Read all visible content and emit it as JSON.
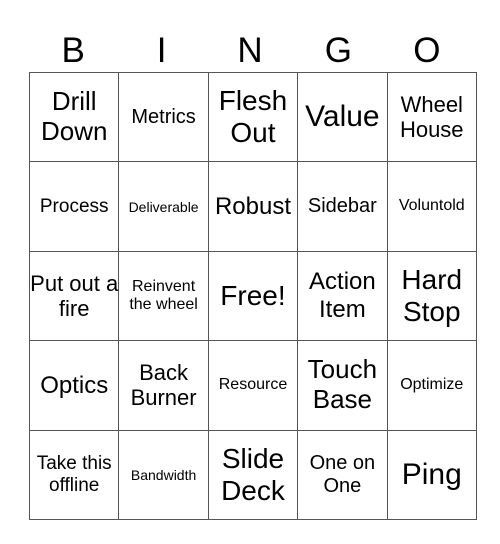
{
  "header": [
    "B",
    "I",
    "N",
    "G",
    "O"
  ],
  "rows": [
    [
      "Drill Down",
      "Metrics",
      "Flesh Out",
      "Value",
      "Wheel House"
    ],
    [
      "Process",
      "Deliverable",
      "Robust",
      "Sidebar",
      "Voluntold"
    ],
    [
      "Put out a fire",
      "Reinvent the wheel",
      "Free!",
      "Action Item",
      "Hard Stop"
    ],
    [
      "Optics",
      "Back Burner",
      "Resource",
      "Touch Base",
      "Optimize"
    ],
    [
      "Take this offline",
      "Bandwidth",
      "Slide Deck",
      "One on One",
      "Ping"
    ]
  ]
}
